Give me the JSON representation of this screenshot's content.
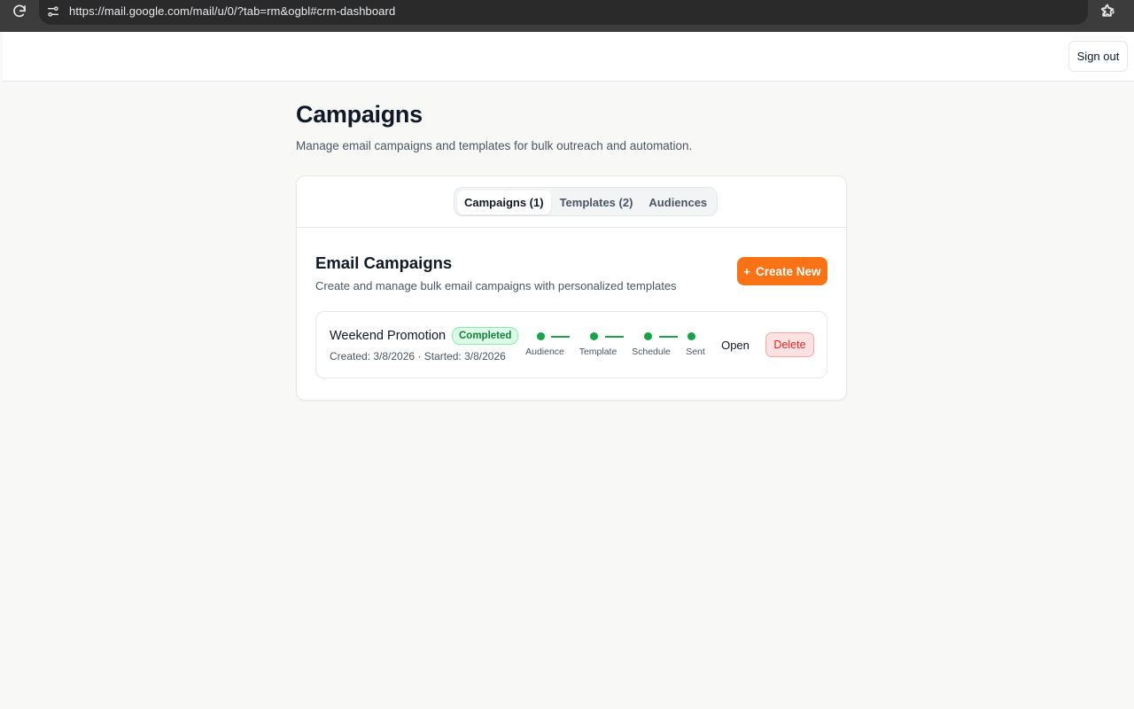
{
  "browser": {
    "url": "https://mail.google.com/mail/u/0/?tab=rm&ogbl#crm-dashboard",
    "icons": [
      "reload-icon",
      "site-info-icon",
      "bookmark-star-icon",
      "extensions-icon"
    ]
  },
  "header": {
    "signout_label": "Sign out"
  },
  "page": {
    "title": "Campaigns",
    "subtitle": "Manage email campaigns and templates for bulk outreach and automation."
  },
  "tabs": [
    {
      "label": "Campaigns (1)",
      "active": true
    },
    {
      "label": "Templates (2)",
      "active": false
    },
    {
      "label": "Audiences",
      "active": false
    }
  ],
  "section": {
    "title": "Email Campaigns",
    "subtitle": "Create and manage bulk email campaigns with personalized templates",
    "create_icon": "+",
    "create_label": "Create New"
  },
  "campaigns": [
    {
      "name": "Weekend Promotion",
      "status": "Completed",
      "meta": "Created: 3/8/2026 · Started: 3/8/2026",
      "steps": [
        {
          "label": "Audience",
          "done": true
        },
        {
          "label": "Template",
          "done": true
        },
        {
          "label": "Schedule",
          "done": true
        },
        {
          "label": "Sent",
          "done": true
        }
      ],
      "open_label": "Open",
      "delete_label": "Delete"
    }
  ],
  "colors": {
    "accent": "#f97316",
    "success": "#16a34a",
    "danger": "#dc2626",
    "background": "#f8f8f7"
  }
}
